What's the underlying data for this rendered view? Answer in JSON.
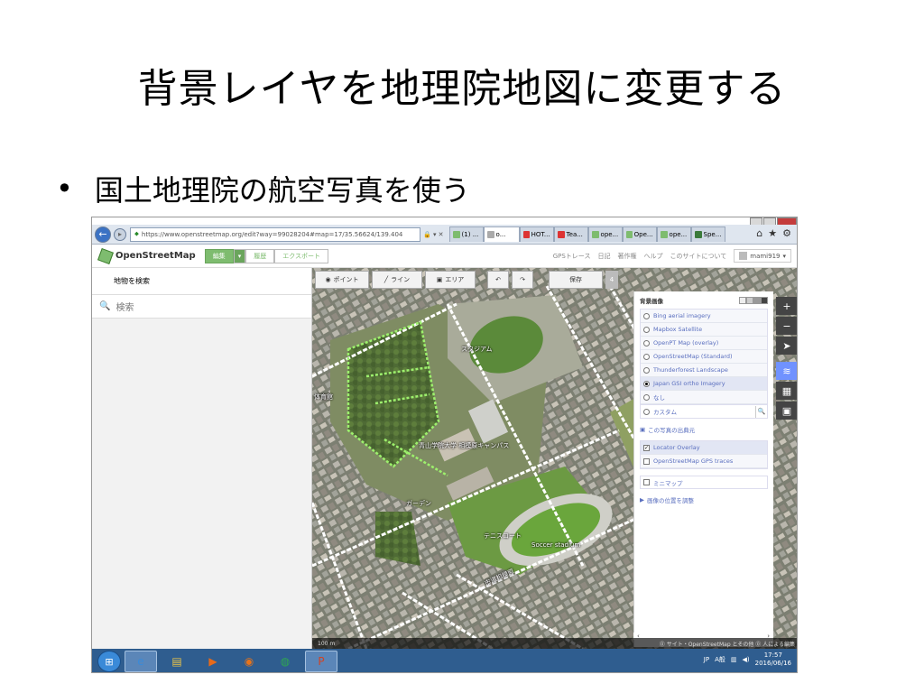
{
  "slide": {
    "title": "背景レイヤを地理院地図に変更する",
    "bullet_marker": "•",
    "bullet_text": "国土地理院の航空写真を使う"
  },
  "browser": {
    "back_icon": "←",
    "forward_icon": "▸",
    "address_url": "https://www.openstreetmap.org/edit?way=99028204#map=17/35.56624/139.404",
    "address_tools": "🔒 ▾ ✕",
    "tabs": [
      {
        "label": "(1) ...",
        "favicon_color": "#7ebc6f",
        "active": false
      },
      {
        "label": "o...",
        "favicon_color": "#aaaaaa",
        "active": true
      },
      {
        "label": "HOT...",
        "favicon_color": "#d33",
        "active": false
      },
      {
        "label": "Tea...",
        "favicon_color": "#d33",
        "active": false
      },
      {
        "label": "ope...",
        "favicon_color": "#7ebc6f",
        "active": false
      },
      {
        "label": "Ope...",
        "favicon_color": "#7ebc6f",
        "active": false
      },
      {
        "label": "ope...",
        "favicon_color": "#7ebc6f",
        "active": false
      },
      {
        "label": "Spe...",
        "favicon_color": "#3a7a3a",
        "active": false
      }
    ],
    "home_icon": "⌂",
    "star_icon": "★",
    "gear_icon": "⚙"
  },
  "osm": {
    "logo_text": "OpenStreetMap",
    "edit_label": "編集",
    "edit_caret": "▾",
    "history_label": "履歴",
    "export_label": "エクスポート",
    "gps_label": "GPSトレース",
    "diary_label": "日記",
    "copyright_label": "著作権",
    "help_label": "ヘルプ",
    "about_label": "このサイトについて",
    "username": "mami919",
    "user_caret": "▾"
  },
  "sidebar": {
    "title": "地物を検索",
    "search_icon": "🔍",
    "search_placeholder": "検索"
  },
  "toolbar": {
    "point_label": "ポイント",
    "line_label": "ライン",
    "area_label": "エリア",
    "undo_icon": "↶",
    "redo_icon": "↷",
    "save_label": "保存",
    "save_count": "4"
  },
  "background_pane": {
    "heading": "背景画像",
    "layers": [
      {
        "label": "Bing aerial imagery",
        "selected": false
      },
      {
        "label": "Mapbox Satellite",
        "selected": false
      },
      {
        "label": "OpenPT Map (overlay)",
        "selected": false
      },
      {
        "label": "OpenStreetMap (Standard)",
        "selected": false
      },
      {
        "label": "Thunderforest Landscape",
        "selected": false
      },
      {
        "label": "Japan GSI ortho Imagery",
        "selected": true
      },
      {
        "label": "なし",
        "selected": false
      }
    ],
    "custom_label": "カスタム",
    "custom_search_icon": "🔍",
    "source_link": "この写真の出典元",
    "overlays": [
      {
        "label": "Locator Overlay",
        "checked": true
      },
      {
        "label": "OpenStreetMap GPS traces",
        "checked": false
      }
    ],
    "check_mark": "✓",
    "minimap_label": "ミニマップ",
    "offset_link": "画像の位置を調整"
  },
  "map_controls": {
    "zoom_in": "+",
    "zoom_out": "−",
    "locate": "➤",
    "layers": "≋",
    "data": "▦",
    "help": "▣"
  },
  "map_labels": {
    "stadium": "スタジアム",
    "gymnasium": "体育館",
    "campus": "青山学院大学 相模原キャンパス",
    "garden": "ガーデン",
    "tennis": "テニスコート",
    "soccer": "Soccer stadium",
    "road": "市道相模原"
  },
  "map_footer": {
    "scale": "100 m",
    "attribution": "⓪ サイト・OpenStreetMap とその他 ⓪ 人による編集"
  },
  "taskbar": {
    "start_icon": "⊞",
    "apps": [
      {
        "name": "ie",
        "glyph": "e",
        "color": "#3a8ad8",
        "active": true
      },
      {
        "name": "explorer",
        "glyph": "▤",
        "color": "#e8c34a",
        "active": false
      },
      {
        "name": "media",
        "glyph": "▶",
        "color": "#e86a1a",
        "active": false
      },
      {
        "name": "firefox",
        "glyph": "◉",
        "color": "#e8731a",
        "active": false
      },
      {
        "name": "chrome",
        "glyph": "◍",
        "color": "#2fa84f",
        "active": false
      },
      {
        "name": "powerpoint",
        "glyph": "P",
        "color": "#d14424",
        "active": true
      }
    ],
    "ime": "JP",
    "ime_mode": "A般",
    "clock_time": "17:57",
    "clock_date": "2016/06/16"
  }
}
